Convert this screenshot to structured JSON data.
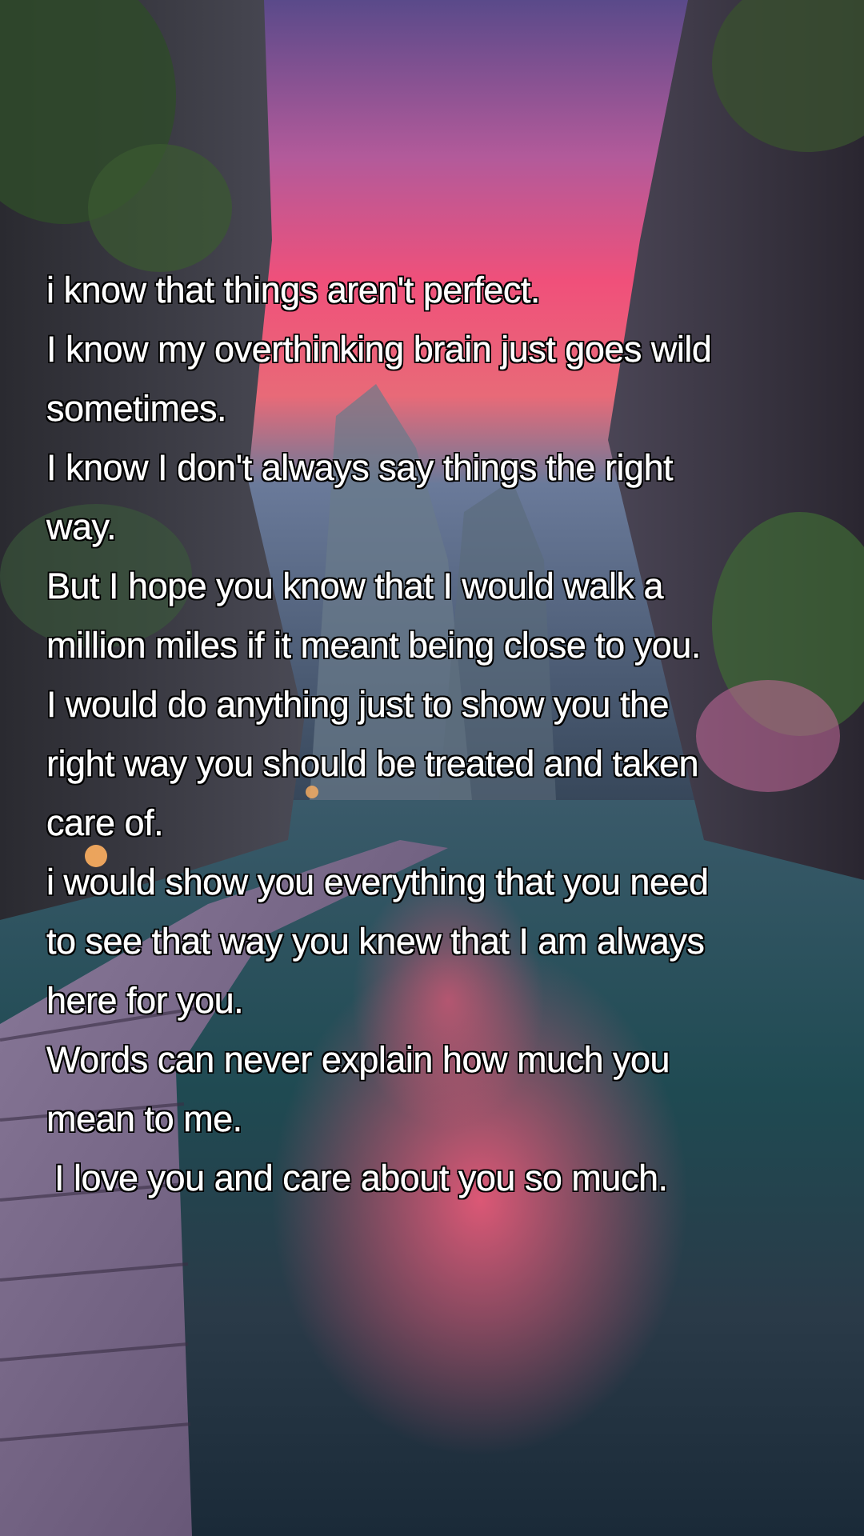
{
  "quote": {
    "lines": [
      "i know that things aren't perfect.",
      "I know my overthinking brain just goes wild",
      "sometimes.",
      "I know I don't always say things the right",
      "way.",
      "But I hope you know that I would walk a",
      "million miles if it meant being close to you.",
      "I would do anything just to show you the",
      "right way you should be treated and taken",
      "care of.",
      "i would show you everything that you need",
      "to see that way you knew that I am always",
      "here for you.",
      "Words can never explain how much you",
      "mean to me.",
      "I love you and care about you so much."
    ]
  },
  "colors": {
    "text": "#ffffff",
    "text_outline": "#000000",
    "sky_pink": "#f0507a",
    "sky_purple": "#6a4a9a",
    "water_teal": "#1f4a52"
  }
}
